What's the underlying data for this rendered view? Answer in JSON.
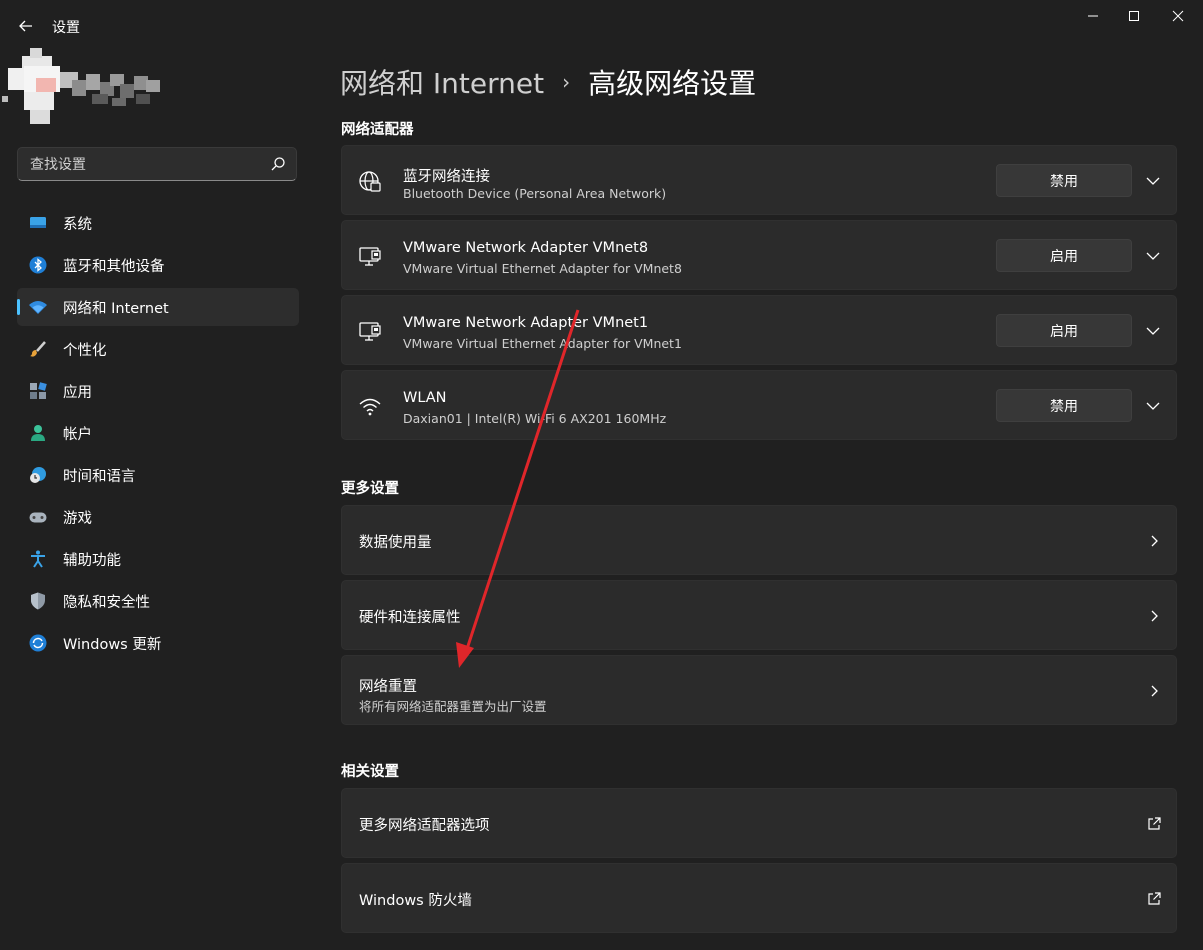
{
  "window": {
    "title": "设置",
    "back_icon": "back-arrow-icon",
    "controls": [
      "minimize-icon",
      "maximize-icon",
      "close-icon"
    ]
  },
  "search": {
    "placeholder": "查找设置",
    "icon": "search-icon"
  },
  "sidebar": {
    "items": [
      {
        "label": "系统",
        "icon": "system-display-icon",
        "active": false
      },
      {
        "label": "蓝牙和其他设备",
        "icon": "bluetooth-icon",
        "active": false
      },
      {
        "label": "网络和 Internet",
        "icon": "wifi-network-icon",
        "active": true
      },
      {
        "label": "个性化",
        "icon": "paintbrush-icon",
        "active": false
      },
      {
        "label": "应用",
        "icon": "apps-icon",
        "active": false
      },
      {
        "label": "帐户",
        "icon": "account-person-icon",
        "active": false
      },
      {
        "label": "时间和语言",
        "icon": "clock-globe-icon",
        "active": false
      },
      {
        "label": "游戏",
        "icon": "gamepad-icon",
        "active": false
      },
      {
        "label": "辅助功能",
        "icon": "accessibility-icon",
        "active": false
      },
      {
        "label": "隐私和安全性",
        "icon": "shield-icon",
        "active": false
      },
      {
        "label": "Windows 更新",
        "icon": "windows-update-icon",
        "active": false
      }
    ],
    "accent_color": "#4cc2ff"
  },
  "breadcrumb": {
    "parent": "网络和 Internet",
    "separator": "›",
    "current": "高级网络设置"
  },
  "sections": {
    "adapters": {
      "title": "网络适配器",
      "items": [
        {
          "title": "蓝牙网络连接",
          "subtitle": "Bluetooth Device (Personal Area Network)",
          "button": "禁用",
          "icon": "globe-network-icon"
        },
        {
          "title": "VMware Network Adapter VMnet8",
          "subtitle": "VMware Virtual Ethernet Adapter for VMnet8",
          "button": "启用",
          "icon": "ethernet-monitor-icon"
        },
        {
          "title": "VMware Network Adapter VMnet1",
          "subtitle": "VMware Virtual Ethernet Adapter for VMnet1",
          "button": "启用",
          "icon": "ethernet-monitor-icon"
        },
        {
          "title": "WLAN",
          "subtitle": "Daxian01 | Intel(R) Wi-Fi 6 AX201 160MHz",
          "button": "禁用",
          "icon": "wifi-icon"
        }
      ]
    },
    "more": {
      "title": "更多设置",
      "items": [
        {
          "title": "数据使用量",
          "subtitle": ""
        },
        {
          "title": "硬件和连接属性",
          "subtitle": ""
        },
        {
          "title": "网络重置",
          "subtitle": "将所有网络适配器重置为出厂设置"
        }
      ]
    },
    "related": {
      "title": "相关设置",
      "items": [
        {
          "title": "更多网络适配器选项",
          "icon": "external-link-icon"
        },
        {
          "title": "Windows 防火墙",
          "icon": "external-link-icon"
        }
      ]
    }
  },
  "annotation_color": "#e0262a"
}
